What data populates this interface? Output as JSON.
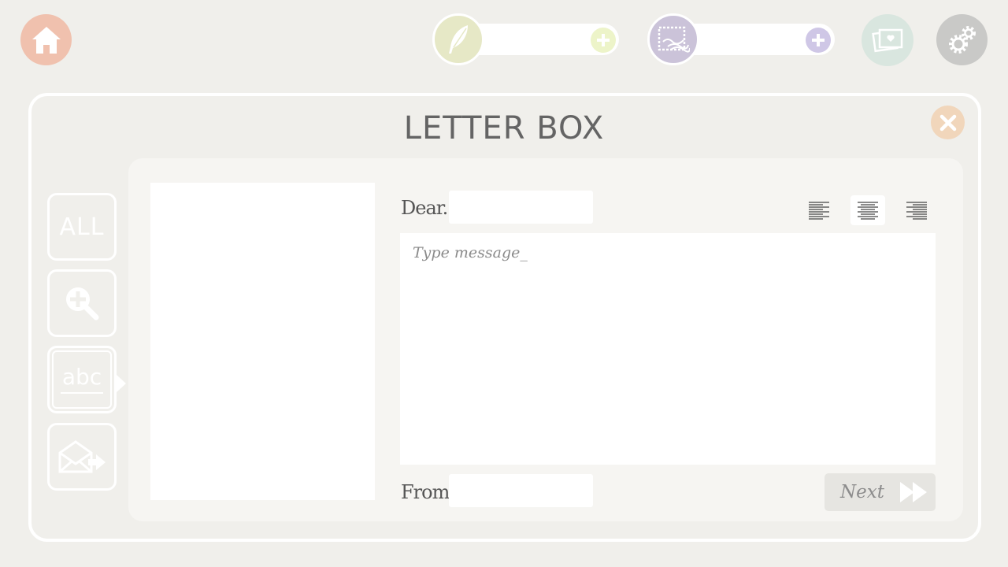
{
  "topbar": {
    "home_icon": "home-icon",
    "quill_counter": {
      "icon": "quill-icon",
      "value": "",
      "plus_icon": "plus-icon",
      "accent": "#e6e8c6",
      "plus_color": "#edf4c9"
    },
    "stamp_counter": {
      "icon": "stamp-icon",
      "value": "",
      "plus_icon": "plus-icon",
      "accent": "#cbc3d9",
      "plus_color": "#cfc7e6"
    },
    "photos_icon": "photos-icon",
    "settings_icon": "gears-icon"
  },
  "dialog": {
    "title": "LETTER BOX",
    "close_icon": "close-icon",
    "sidebar": [
      {
        "id": "all",
        "label": "ALL",
        "active": false
      },
      {
        "id": "zoom",
        "icon": "zoom-in-icon",
        "active": false
      },
      {
        "id": "write",
        "label": "abc",
        "active": true
      },
      {
        "id": "send",
        "icon": "send-envelope-icon",
        "active": false
      }
    ],
    "form": {
      "dear_label": "Dear.",
      "dear_value": "",
      "message_placeholder": "Type message_",
      "from_label": "From.",
      "from_value": "",
      "alignment": {
        "options": [
          "left",
          "center",
          "right"
        ],
        "selected": "center"
      },
      "next_label": "Next"
    }
  },
  "colors": {
    "background": "#f0efeb",
    "home": "#f0c1ae",
    "close": "#f1d6bb",
    "photos": "#d9e6df",
    "settings": "#c9c9c7",
    "panel": "#f6f5f2"
  }
}
